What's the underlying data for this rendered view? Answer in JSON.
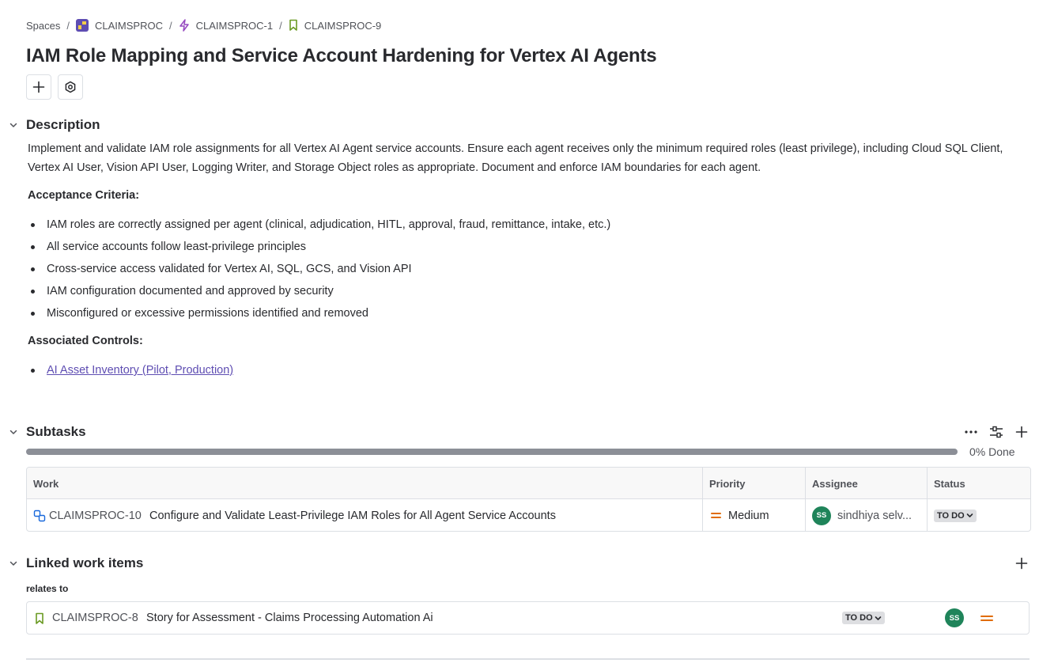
{
  "breadcrumb": {
    "spaces": "Spaces",
    "project": "CLAIMSPROC",
    "epic": "CLAIMSPROC-1",
    "story": "CLAIMSPROC-9",
    "separator": "/"
  },
  "page": {
    "title": "IAM Role Mapping and Service Account Hardening for Vertex AI Agents"
  },
  "toolbar": {
    "add_icon": "plus-icon",
    "apps_icon": "hexagon-icon"
  },
  "description": {
    "heading": "Description",
    "body": "Implement and validate IAM role assignments for all Vertex AI Agent service accounts. Ensure each agent receives only the minimum required roles (least privilege), including Cloud SQL Client, Vertex AI User, Vision API User, Logging Writer, and Storage Object roles as appropriate. Document and enforce IAM boundaries for each agent.",
    "acceptance_label": "Acceptance Criteria:",
    "acceptance_items": [
      "IAM roles are correctly assigned per agent (clinical, adjudication, HITL, approval, fraud, remittance, intake, etc.)",
      "All service accounts follow least-privilege principles",
      "Cross-service access validated for Vertex AI, SQL, GCS, and Vision API",
      "IAM configuration documented and approved by security",
      "Misconfigured or excessive permissions identified and removed"
    ],
    "controls_label": "Associated Controls:",
    "controls_items": [
      "AI Asset Inventory (Pilot, Production)"
    ]
  },
  "subtasks": {
    "heading": "Subtasks",
    "progress_percent": 0,
    "progress_label": "0% Done",
    "columns": [
      "Work",
      "Priority",
      "Assignee",
      "Status"
    ],
    "rows": [
      {
        "key": "CLAIMSPROC-10",
        "summary": "Configure and Validate Least-Privilege IAM Roles for All Agent Service Accounts",
        "priority": "Medium",
        "assignee_initials": "SS",
        "assignee": "sindhiya selv...",
        "status": "TO DO"
      }
    ]
  },
  "linked": {
    "heading": "Linked work items",
    "relation": "relates to",
    "items": [
      {
        "key": "CLAIMSPROC-8",
        "summary": "Story for Assessment - Claims Processing Automation Ai",
        "status": "TO DO",
        "assignee_initials": "SS"
      }
    ]
  },
  "colors": {
    "accent_purple": "#5e4db2",
    "story_green": "#6a9a23",
    "priority_orange": "#e06c00",
    "avatar_green": "#1f845a"
  }
}
